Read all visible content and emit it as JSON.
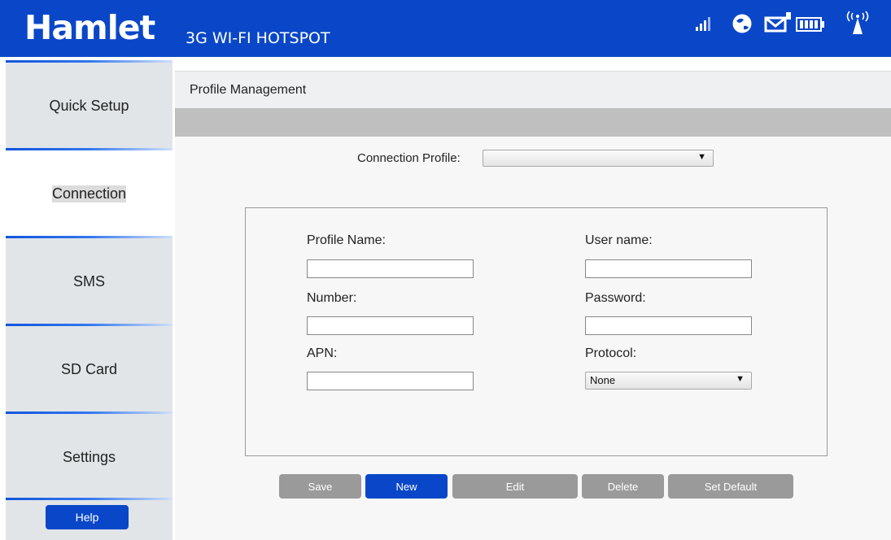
{
  "header": {
    "brand": "Hamlet",
    "subtitle": "3G WI-FI HOTSPOT",
    "status_icons": [
      "signal-strength-icon",
      "internet-globe-icon",
      "sms-envelope-icon",
      "battery-icon",
      "wifi-broadcast-icon"
    ]
  },
  "sidebar": {
    "items": [
      {
        "label": "Quick Setup"
      },
      {
        "label": "Connection"
      },
      {
        "label": "SMS"
      },
      {
        "label": "SD Card"
      },
      {
        "label": "Settings"
      }
    ],
    "active_index": 1,
    "help_label": "Help"
  },
  "main": {
    "title": "Profile Management",
    "connection_profile_label": "Connection Profile:",
    "connection_profile_value": "",
    "form": {
      "profile_name_label": "Profile Name:",
      "profile_name_value": "",
      "number_label": "Number:",
      "number_value": "",
      "apn_label": "APN:",
      "apn_value": "",
      "user_name_label": "User name:",
      "user_name_value": "",
      "password_label": "Password:",
      "password_value": "",
      "protocol_label": "Protocol:",
      "protocol_value": "None"
    },
    "buttons": {
      "save": "Save",
      "new": "New",
      "edit": "Edit",
      "delete": "Delete",
      "set_default": "Set Default"
    }
  },
  "colors": {
    "brand_blue": "#0a47c8",
    "disabled_button": "#9a9a9a",
    "sidebar_bg": "#e1e5e8",
    "grey_bar": "#bfbfbf"
  }
}
